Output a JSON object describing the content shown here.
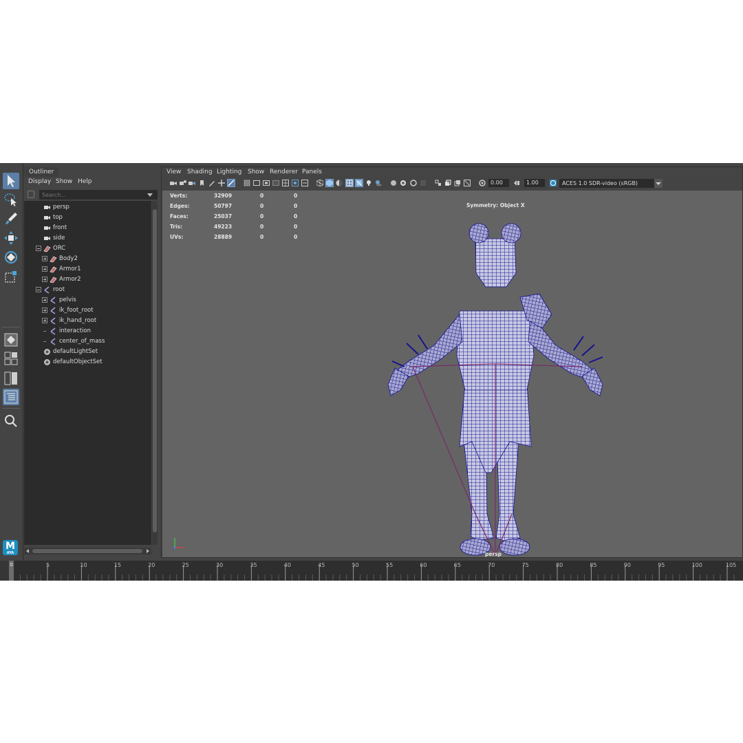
{
  "outliner": {
    "tab_label": "Outliner",
    "menu": [
      "Display",
      "Show",
      "Help"
    ],
    "search_placeholder": "Search...",
    "items": [
      {
        "label": "persp",
        "type": "camera"
      },
      {
        "label": "top",
        "type": "camera"
      },
      {
        "label": "front",
        "type": "camera"
      },
      {
        "label": "side",
        "type": "camera"
      },
      {
        "label": "ORC",
        "type": "mesh-group"
      },
      {
        "label": "Body2",
        "type": "mesh"
      },
      {
        "label": "Armor1",
        "type": "mesh"
      },
      {
        "label": "Armor2",
        "type": "mesh"
      },
      {
        "label": "root",
        "type": "joint"
      },
      {
        "label": "pelvis",
        "type": "joint"
      },
      {
        "label": "ik_foot_root",
        "type": "joint"
      },
      {
        "label": "ik_hand_root",
        "type": "joint"
      },
      {
        "label": "interaction",
        "type": "joint"
      },
      {
        "label": "center_of_mass",
        "type": "joint"
      },
      {
        "label": "defaultLightSet",
        "type": "set"
      },
      {
        "label": "defaultObjectSet",
        "type": "set"
      }
    ]
  },
  "viewport": {
    "menu": [
      "View",
      "Shading",
      "Lighting",
      "Show",
      "Renderer",
      "Panels"
    ],
    "exposure": "0.00",
    "gamma": "1.00",
    "color_space": "ACES 1.0 SDR-video (sRGB)",
    "hud": [
      {
        "label": "Verts:",
        "v1": "32909",
        "v2": "0",
        "v3": "0"
      },
      {
        "label": "Edges:",
        "v1": "50797",
        "v2": "0",
        "v3": "0"
      },
      {
        "label": "Faces:",
        "v1": "25037",
        "v2": "0",
        "v3": "0"
      },
      {
        "label": "Tris:",
        "v1": "49223",
        "v2": "0",
        "v3": "0"
      },
      {
        "label": "UVs:",
        "v1": "28889",
        "v2": "0",
        "v3": "0"
      }
    ],
    "symmetry": "Symmetry: Object X",
    "camera": "persp",
    "wire_color": "#1c1a9a"
  },
  "timeline": {
    "current_frame": "0",
    "ticks": [
      "5",
      "10",
      "15",
      "20",
      "25",
      "30",
      "35",
      "40",
      "45",
      "50",
      "55",
      "60",
      "65",
      "70",
      "75",
      "80",
      "85",
      "90",
      "95",
      "100",
      "105"
    ]
  },
  "logo": {
    "letter": "M",
    "sub": "AYA"
  },
  "colors": {
    "accent": "#5b7fa8",
    "panel": "#444444",
    "viewport": "#646464"
  }
}
